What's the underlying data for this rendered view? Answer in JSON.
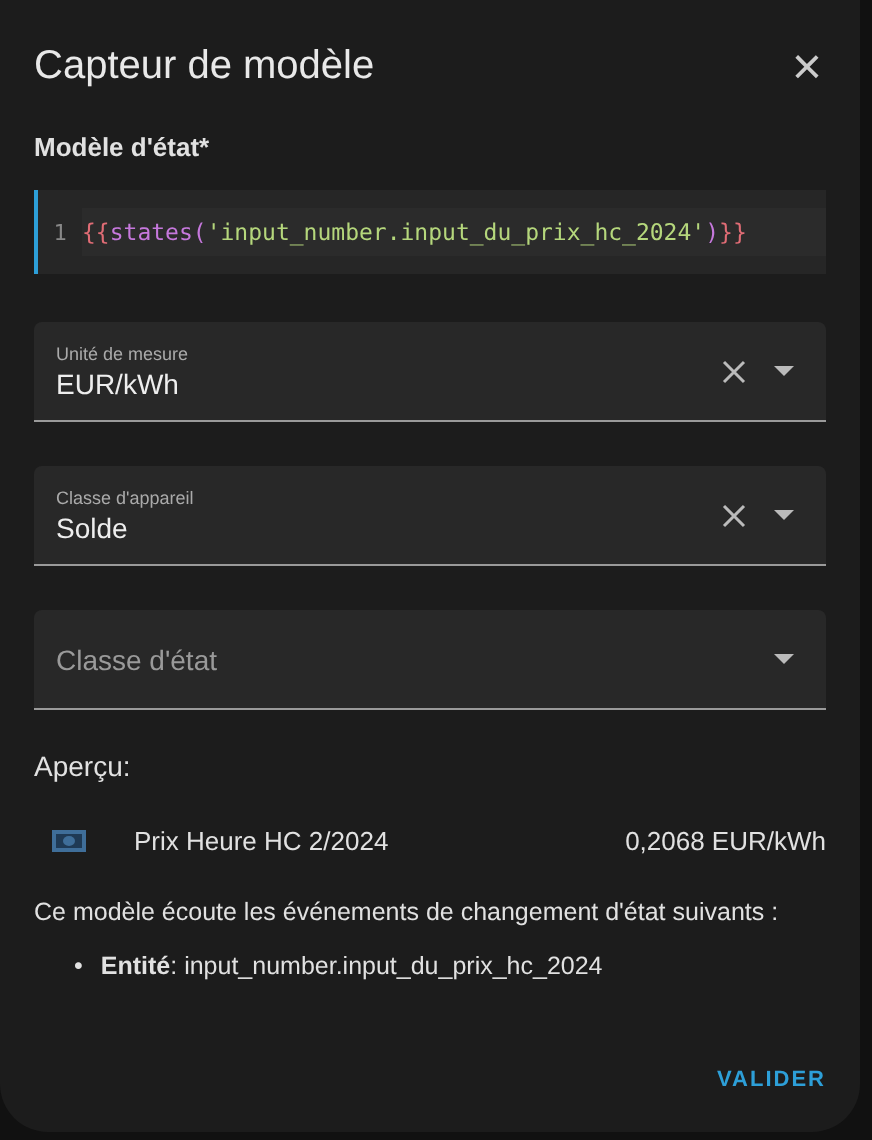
{
  "dialog": {
    "title": "Capteur de modèle",
    "close_icon": "×"
  },
  "template": {
    "label": "Modèle d'état*",
    "line_number": "1",
    "tokens": [
      {
        "text": "{{",
        "kind": "brace"
      },
      {
        "text": "states(",
        "kind": "func"
      },
      {
        "text": "'input_number.input_du_prix_hc_2024'",
        "kind": "string"
      },
      {
        "text": ")",
        "kind": "func"
      },
      {
        "text": "}}",
        "kind": "brace"
      }
    ]
  },
  "fields": [
    {
      "label": "Unité de mesure",
      "value": "EUR/kWh",
      "clearable": true
    },
    {
      "label": "Classe d'appareil",
      "value": "Solde",
      "clearable": true
    },
    {
      "label": "Classe d'état",
      "clearable": false
    }
  ],
  "preview": {
    "heading": "Aperçu:",
    "name": "Prix Heure HC 2/2024",
    "state": "0,2068 EUR/kWh"
  },
  "listeners": {
    "text": "Ce modèle écoute les événements de changement d'état suivants :",
    "bullet": "•",
    "items": [
      "**Entité**: input_number.input_du_prix_hc_2024"
    ]
  },
  "buttons": [
    "VALIDER"
  ]
}
